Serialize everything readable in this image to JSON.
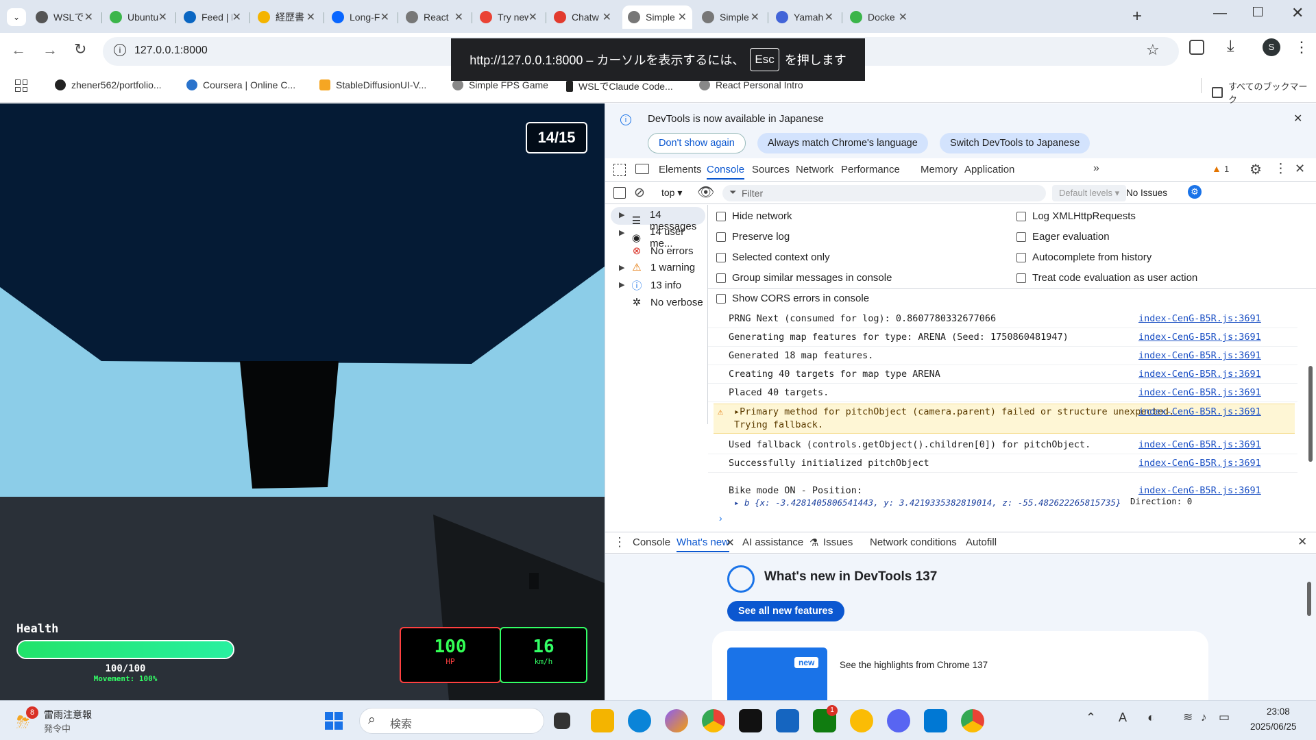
{
  "tabs": [
    {
      "label": "WSLでC",
      "color": "#555"
    },
    {
      "label": "Ubuntu",
      "color": "#3bb54a"
    },
    {
      "label": "Feed | L",
      "color": "#0a66c2"
    },
    {
      "label": "経歴書",
      "color": "#f4b400"
    },
    {
      "label": "Long-F",
      "color": "#0866ff"
    },
    {
      "label": "React",
      "color": "#777"
    },
    {
      "label": "Try new",
      "color": "#ea4335"
    },
    {
      "label": "Chatw",
      "color": "#e23b2e"
    },
    {
      "label": "Simple",
      "color": "#777"
    },
    {
      "label": "Simple",
      "color": "#777"
    },
    {
      "label": "Yamah",
      "color": "#4264d8"
    },
    {
      "label": "Docke",
      "color": "#3bb54a"
    }
  ],
  "address": "127.0.0.1:8000",
  "fullscreen_notice": {
    "pre": "http://127.0.0.1:8000 – カーソルを表示するには、",
    "key": "Esc",
    "post": "を押します"
  },
  "profile_initial": "S",
  "bookmarks": [
    "zhener562/portfolio...",
    "Coursera | Online C...",
    "StableDiffusionUI-V...",
    "Simple FPS Game",
    "WSLでClaude Code...",
    "React Personal Intro"
  ],
  "all_bookmarks": "すべてのブックマーク",
  "game": {
    "counter": "14/15",
    "health_label": "Health",
    "health_text": "100/100",
    "health_fraction": 1.0,
    "movement": "Movement: 100%",
    "hp_value": "100",
    "hp_unit": "HP",
    "speed_value": "16",
    "speed_unit": "km/h"
  },
  "devtools": {
    "banner": "DevTools is now available in Japanese",
    "banner_buttons": [
      "Don't show again",
      "Always match Chrome's language",
      "Switch DevTools to Japanese"
    ],
    "tabs": [
      "Elements",
      "Console",
      "Sources",
      "Network",
      "Performance",
      "Memory",
      "Application"
    ],
    "warning_count": "1",
    "context": "top",
    "filter_placeholder": "Filter",
    "levels": "Default levels",
    "issues": "No Issues",
    "sidebar": [
      "14 messages",
      "14 user me...",
      "No errors",
      "1 warning",
      "13 info",
      "No verbose"
    ],
    "checkboxes_left": [
      "Hide network",
      "Preserve log",
      "Selected context only",
      "Group similar messages in console",
      "Show CORS errors in console"
    ],
    "checkboxes_right": [
      "Log XMLHttpRequests",
      "Eager evaluation",
      "Autocomplete from history",
      "Treat code evaluation as user action"
    ],
    "source": "index-CenG-B5R.js:3691",
    "log": [
      "PRNG Next (consumed for log): 0.8607780332677066",
      "Generating map features for type: ARENA (Seed: 1750860481947)",
      "Generated 18 map features.",
      "Creating 40 targets for map type ARENA",
      "Placed 40 targets."
    ],
    "warning_line1": "Primary method for pitchObject (camera.parent) failed or structure unexpected.",
    "warning_line2": "Trying fallback.",
    "log2": [
      "Used fallback (controls.getObject().children[0]) for pitchObject.",
      "Successfully initialized pitchObject"
    ],
    "bike_line": "Bike mode ON - Position:",
    "bike_obj": "▸ b {x: -3.4281405806541443, y: 3.4219335382819014, z: -55.482622265815735}",
    "bike_dir": "Direction: 0",
    "drawer_tabs": [
      "Console",
      "What's new",
      "AI assistance",
      "Issues",
      "Network conditions",
      "Autofill"
    ],
    "whatsnew_title": "What's new in DevTools 137",
    "whatsnew_button": "See all new features",
    "new_badge": "new",
    "highlights": "See the highlights from Chrome 137"
  },
  "taskbar": {
    "weather_badge": "8",
    "weather_title": "雷雨注意報",
    "weather_sub": "発令中",
    "search": "検索",
    "time": "23:08",
    "date": "2025/06/25",
    "chrome_badge": "1"
  }
}
